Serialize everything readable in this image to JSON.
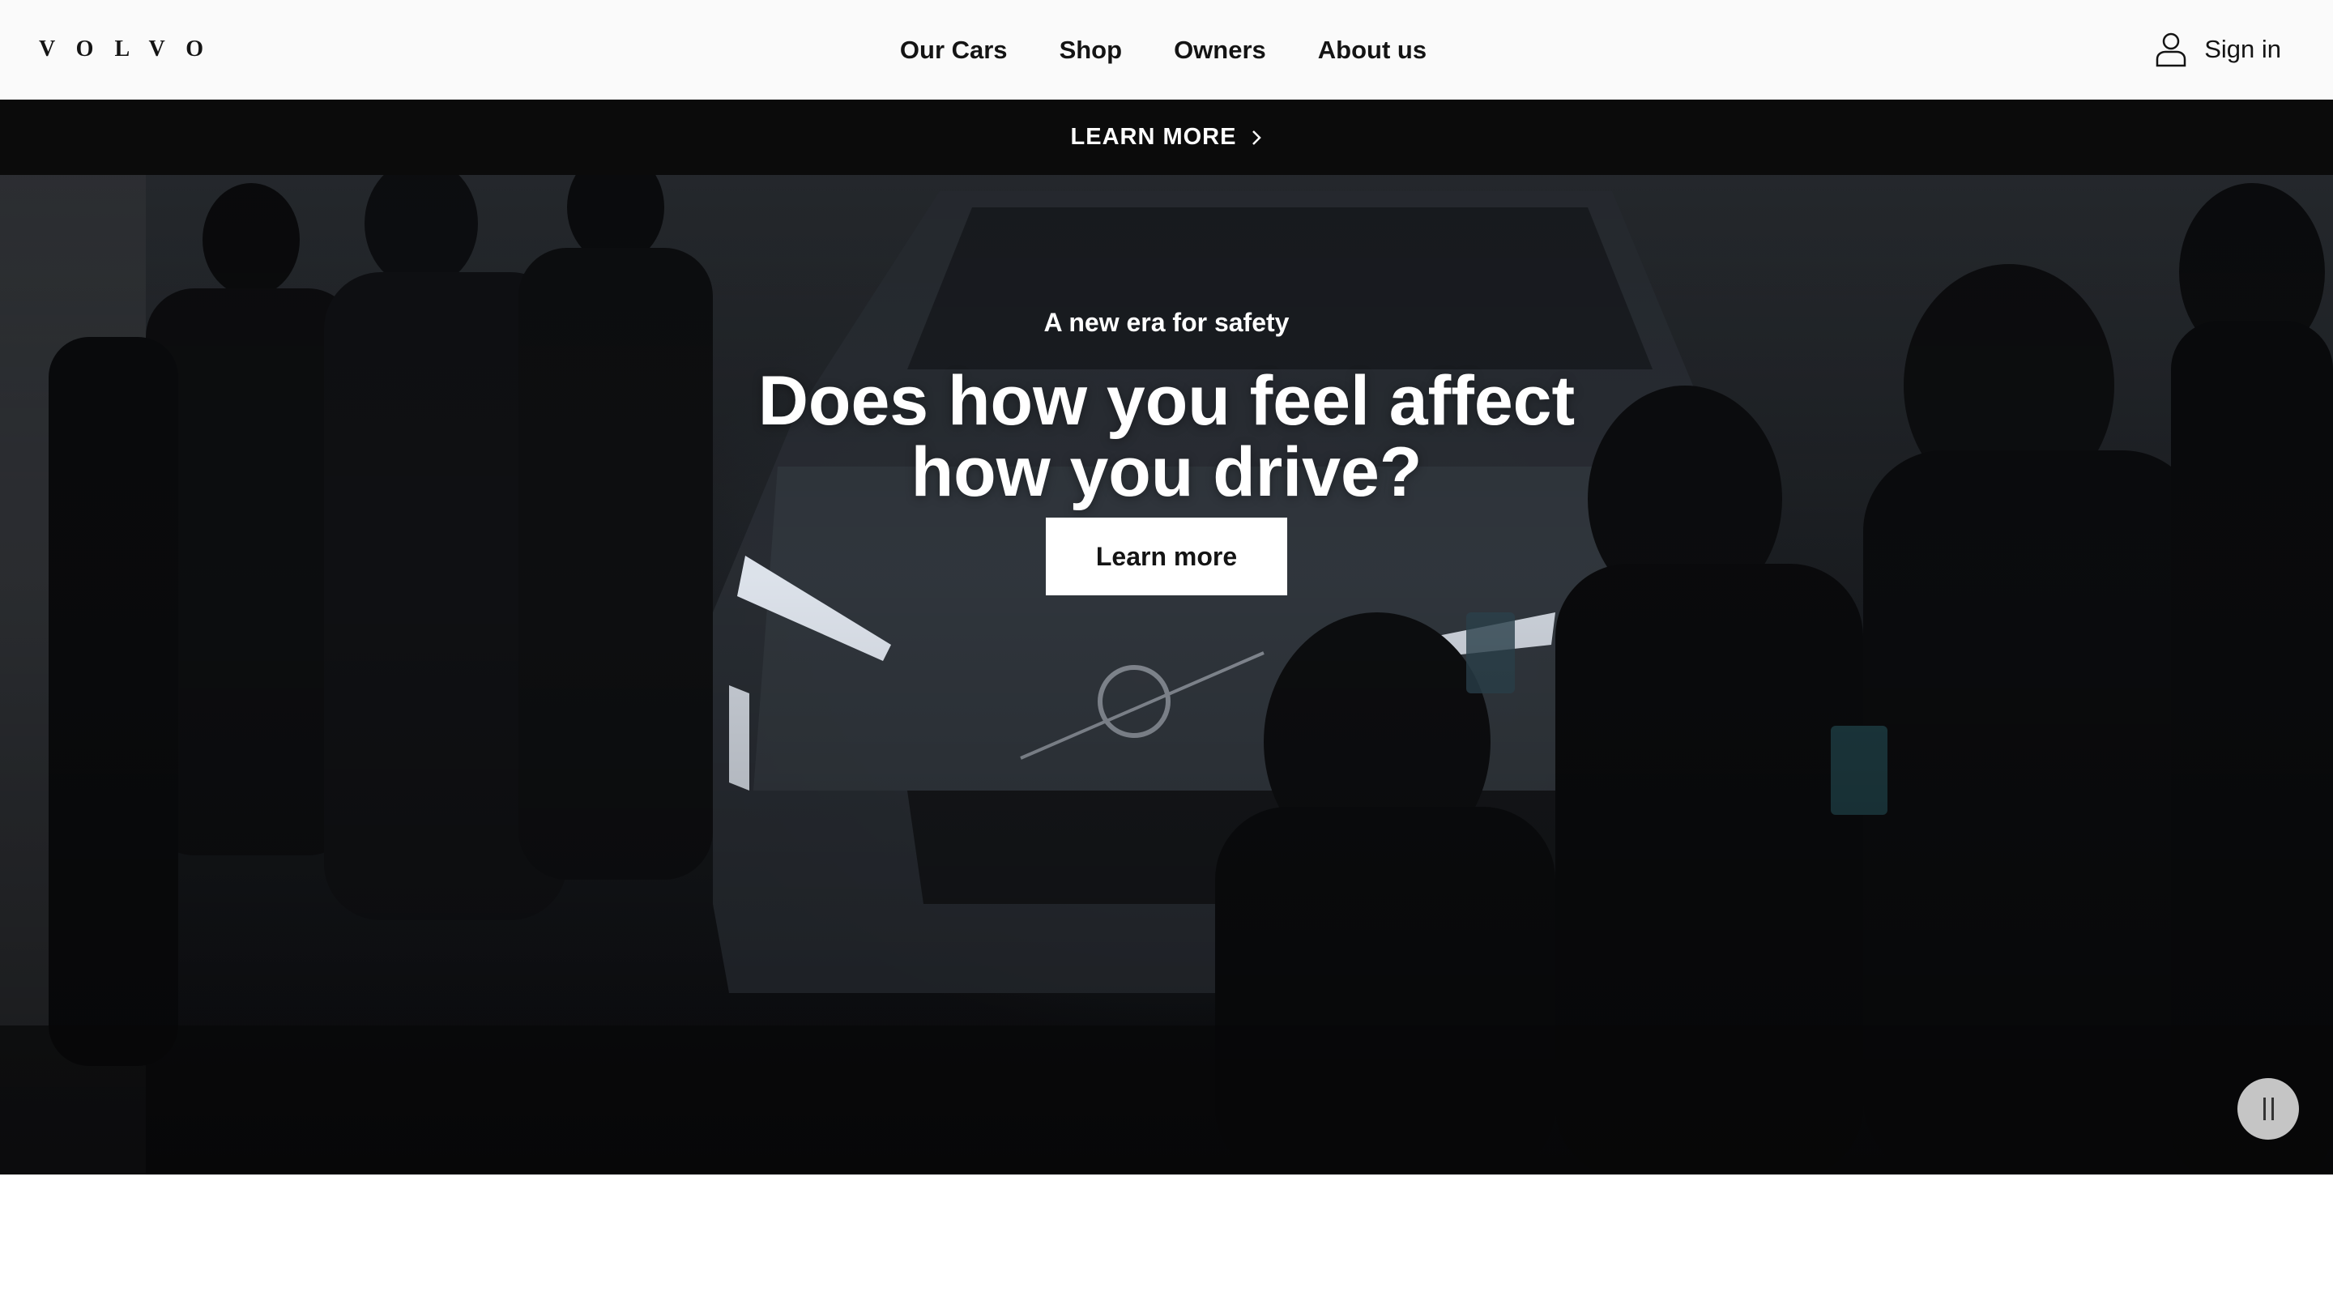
{
  "header": {
    "logo_text": "VOLVO",
    "nav": [
      {
        "label": "Our Cars"
      },
      {
        "label": "Shop"
      },
      {
        "label": "Owners"
      },
      {
        "label": "About us"
      }
    ],
    "signin_label": "Sign in",
    "signin_icon": "user-icon"
  },
  "promo": {
    "label": "LEARN MORE",
    "icon": "chevron-right-icon"
  },
  "hero": {
    "eyebrow": "A new era for safety",
    "headline": "Does how you feel affect how you drive?",
    "cta_label": "Learn more",
    "pause_icon": "pause-icon"
  }
}
